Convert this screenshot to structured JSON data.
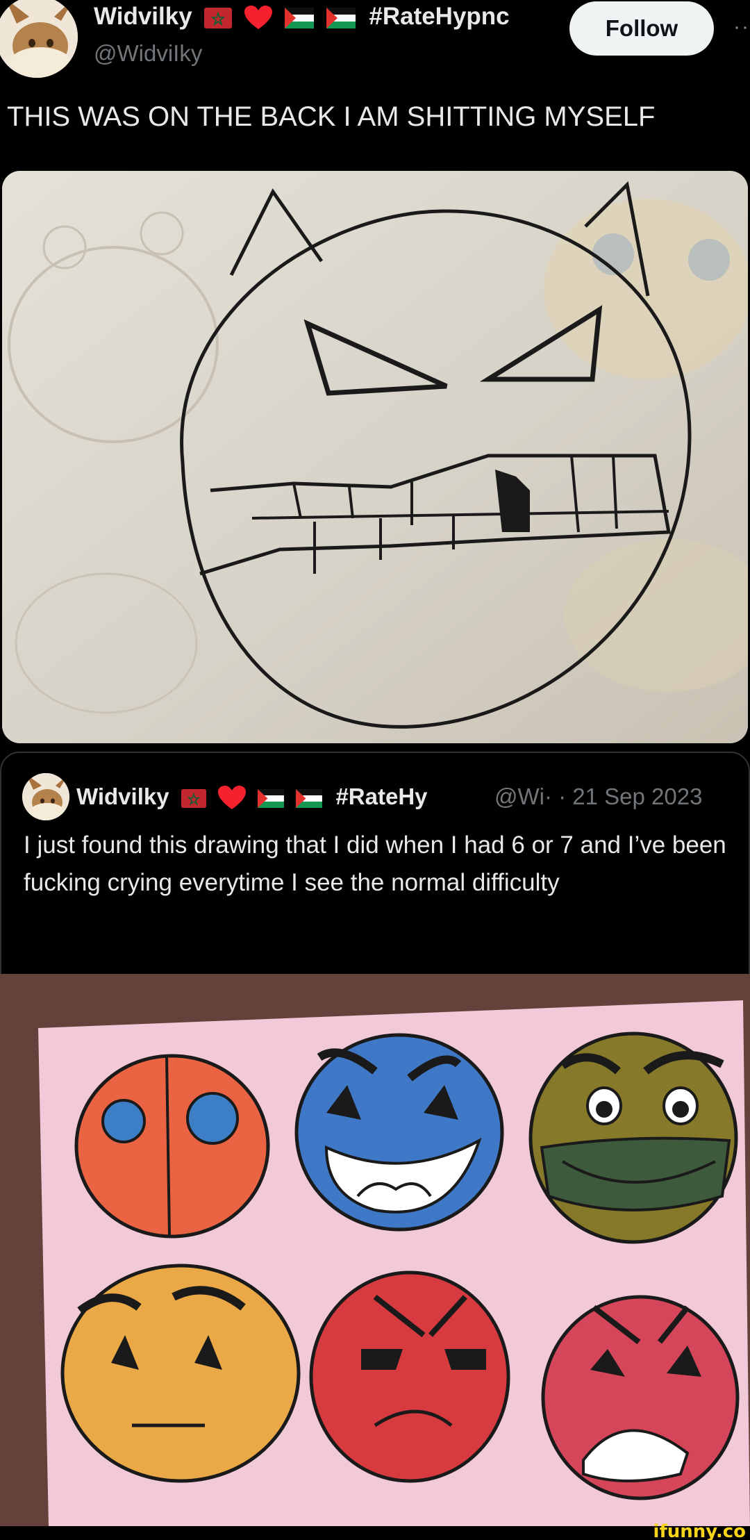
{
  "header": {
    "display_name": "Widvilky",
    "hashtag": "#RateHypnc",
    "handle": "@WidviIky",
    "follow_label": "Follow",
    "more_label": "··"
  },
  "tweet": {
    "text": "THIS WAS ON THE BACK I AM SHITTING MYSELF"
  },
  "quoted": {
    "display_name": "Widvilky",
    "hashtag": "#RateHy",
    "handle_date": "@Wi· · 21 Sep 2023",
    "text": "I just found this drawing that I did when I had 6 or 7 and I’ve been fucking crying everytime I see the normal difficulty"
  },
  "watermark": "ifunny.co",
  "colors": {
    "background": "#000000",
    "text": "#e7e9ea",
    "secondary": "#71767b",
    "heart": "#f4212e",
    "follow_bg": "#eff3f4",
    "watermark": "#f7d31a"
  },
  "icons": [
    "eevee-avatar",
    "morocco-flag-icon",
    "red-heart-icon",
    "palestine-flag-icon"
  ]
}
